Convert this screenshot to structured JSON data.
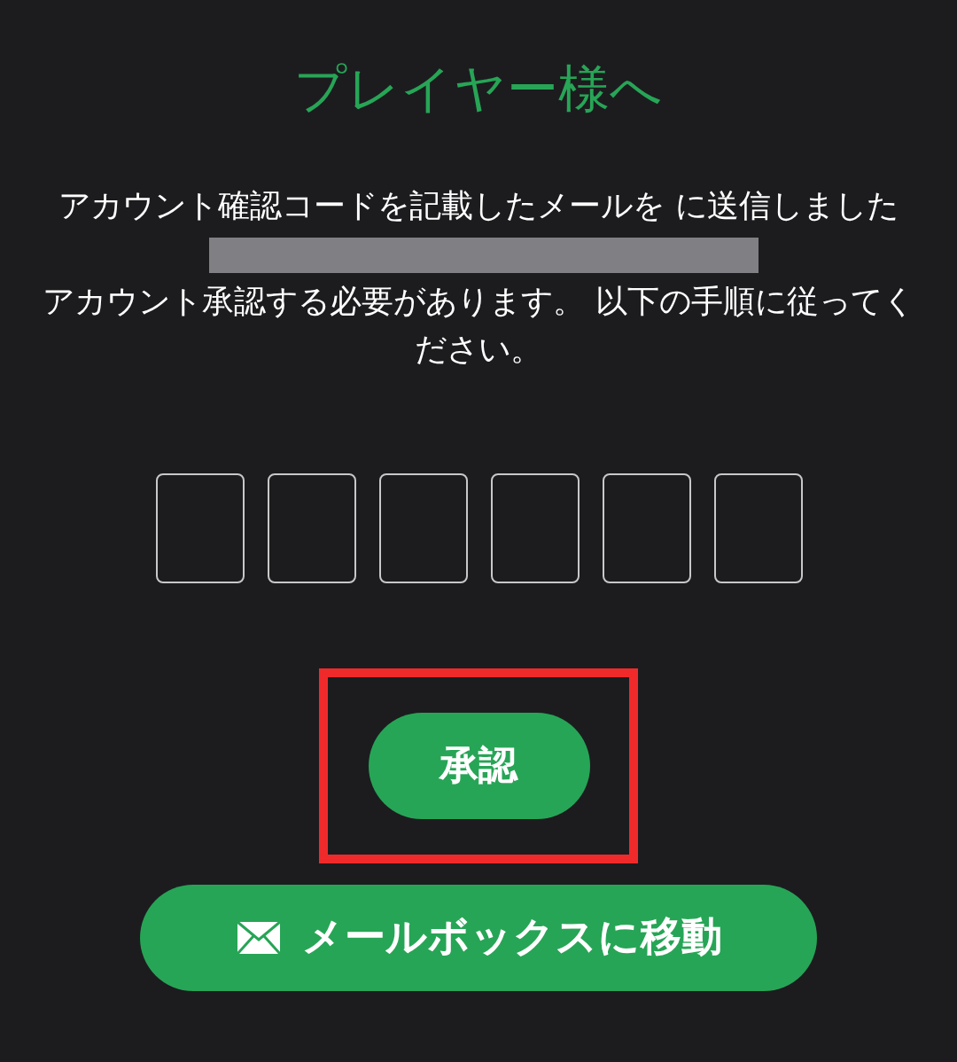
{
  "title": "プレイヤー様へ",
  "message": {
    "before_redaction": "アカウント確認コードを記載したメールを に送信しました",
    "redacted": true,
    "after": "アカウント承認する必要があります。 以下の手順に従ってください。"
  },
  "code_fields": [
    {
      "kind": "digit"
    },
    {
      "kind": "digit"
    },
    {
      "kind": "digit"
    },
    {
      "kind": "digit"
    },
    {
      "kind": "digit"
    },
    {
      "kind": "digit"
    }
  ],
  "approve_button": {
    "label": "承認",
    "highlighted": true
  },
  "mailbox_button": {
    "label": "メールボックスに移動"
  }
}
